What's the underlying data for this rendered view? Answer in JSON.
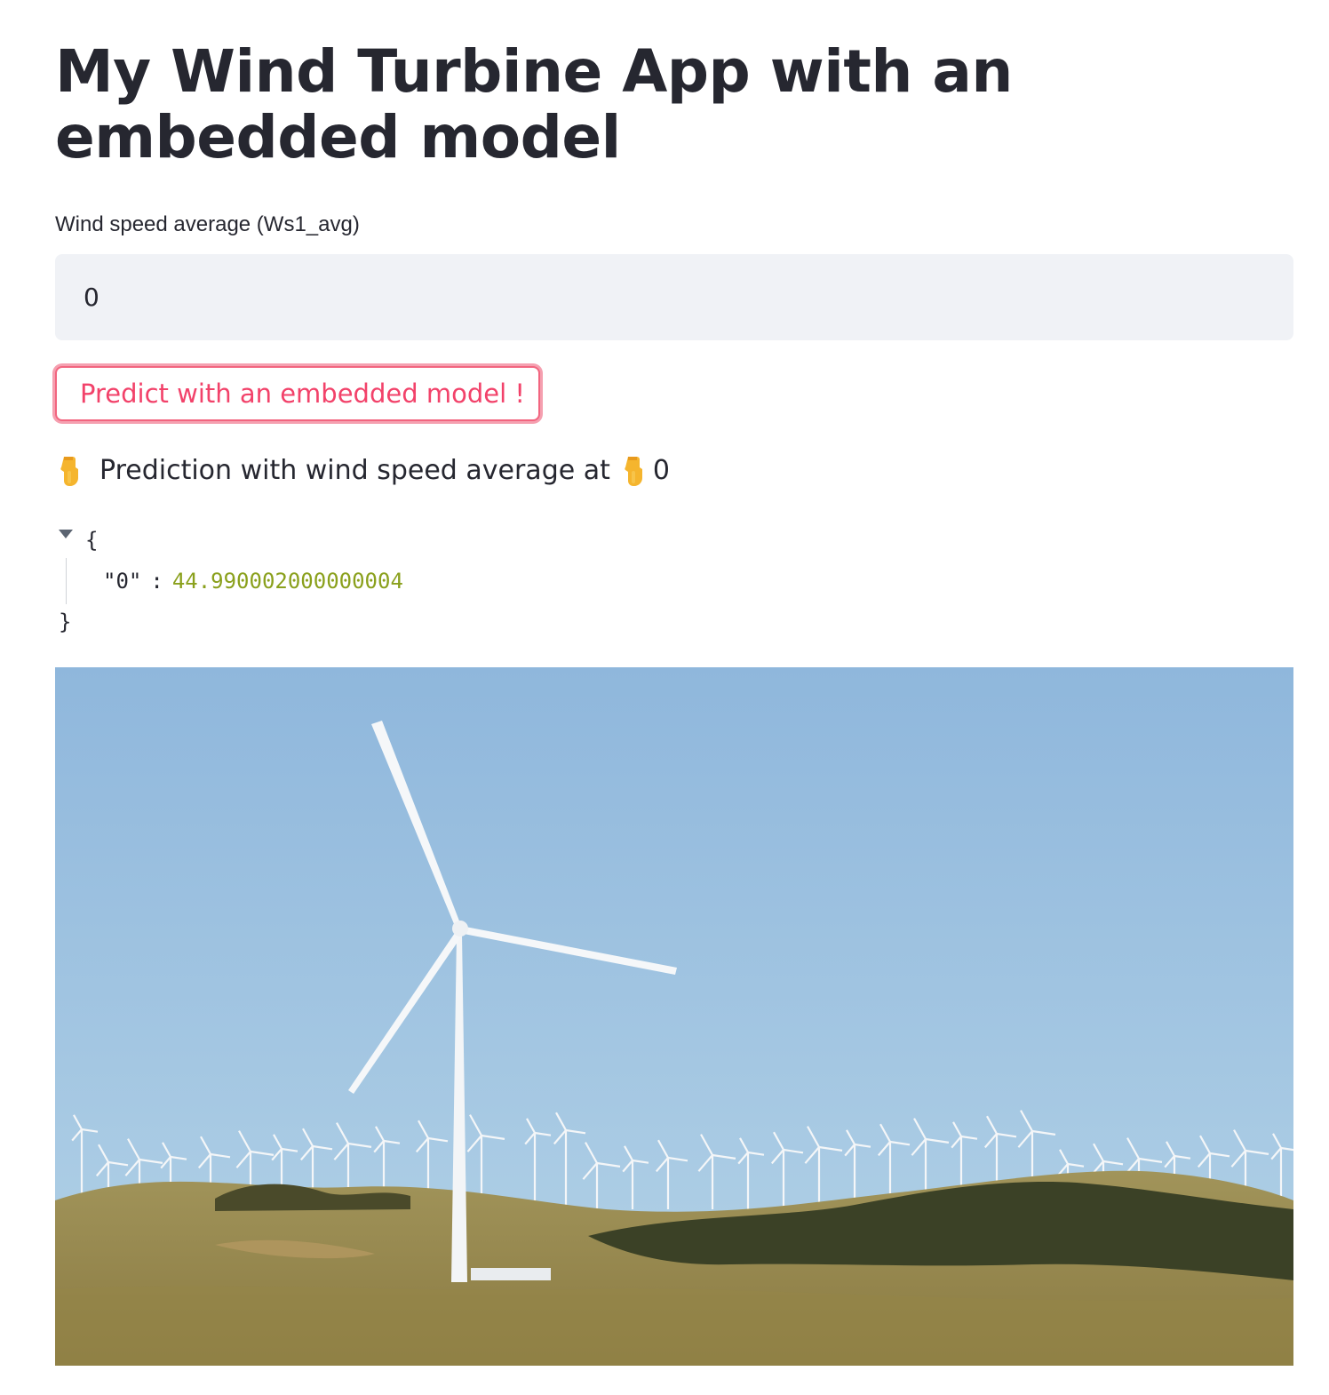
{
  "page": {
    "title": "My Wind Turbine App with an embedded model"
  },
  "input": {
    "label": "Wind speed average (Ws1_avg)",
    "value": "0"
  },
  "button": {
    "label": "Predict with an embedded model !"
  },
  "prediction": {
    "text": "Prediction with wind speed average at",
    "value": "0",
    "icon": "backhand-index-pointing-down-icon"
  },
  "json_output": {
    "open_brace": "{",
    "key": "\"0\"",
    "colon": ":",
    "value": "44.990002000000004",
    "close_brace": "}"
  },
  "image": {
    "subject": "wind-farm-photo"
  },
  "colors": {
    "accent": "#f2426a",
    "button_border": "#f2657f",
    "input_bg": "#f0f2f6",
    "text": "#262730",
    "json_number": "#8aa01c",
    "sky": "#9fc4e0",
    "hills": "#9a8a4c"
  }
}
